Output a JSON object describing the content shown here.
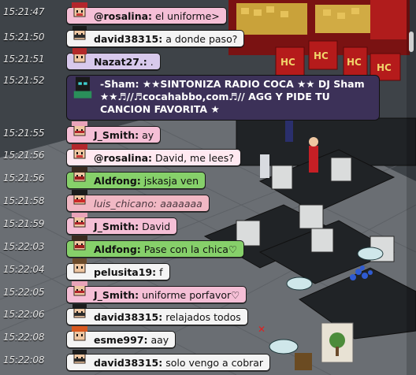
{
  "colors": {
    "bubble_default": "#f4f4f4",
    "bubble_pink": "#f5bfd6",
    "bubble_green": "#86d06a",
    "bubble_lilac": "#d8c9ec",
    "sham_bubble": "#3c3158"
  },
  "room": {
    "signs": [
      "HC",
      "HC",
      "HC",
      "HC"
    ]
  },
  "chat": [
    {
      "time": "15:21:47",
      "nick": "@rosalina:",
      "text": " el uniforme>",
      "style": "pink"
    },
    {
      "time": "15:21:50",
      "nick": "david38315:",
      "text": " a donde paso?",
      "style": "default"
    },
    {
      "time": "15:21:51",
      "nick": "Nazat27.:",
      "text": " .",
      "style": "lilac"
    },
    {
      "time": "15:21:52",
      "nick": "-Sham:",
      "text": " ★★SINTONIZA RADIO COCA ★★ DJ Sham ★★♬//♬cocahabbo,com♬// AGG Y PIDE TU CANCION FAVORITA ★",
      "style": "sham"
    },
    {
      "time": "15:21:55",
      "nick": "J_Smith:",
      "text": " ay",
      "style": "pink"
    },
    {
      "time": "15:21:56",
      "nick": "@rosalina:",
      "text": " David, me lees?",
      "style": "notice"
    },
    {
      "time": "15:21:56",
      "nick": "Aldfong:",
      "text": " jskasja ven",
      "style": "green"
    },
    {
      "time": "15:21:58",
      "nick": "luis_chicano:",
      "text": " aaaaaaa",
      "style": "shout"
    },
    {
      "time": "15:21:59",
      "nick": "J_Smith:",
      "text": " David",
      "style": "pink"
    },
    {
      "time": "15:22:03",
      "nick": "Aldfong:",
      "text": " Pase con la chica♡",
      "style": "green"
    },
    {
      "time": "15:22:04",
      "nick": "pelusita19:",
      "text": " f",
      "style": "default"
    },
    {
      "time": "15:22:05",
      "nick": "J_Smith:",
      "text": " uniforme porfavor♡",
      "style": "pink"
    },
    {
      "time": "15:22:06",
      "nick": "david38315:",
      "text": " relajados todos",
      "style": "default"
    },
    {
      "time": "15:22:08",
      "nick": "esme997:",
      "text": " aay",
      "style": "default"
    },
    {
      "time": "15:22:08",
      "nick": "david38315:",
      "text": " solo vengo a cobrar",
      "style": "default"
    }
  ]
}
